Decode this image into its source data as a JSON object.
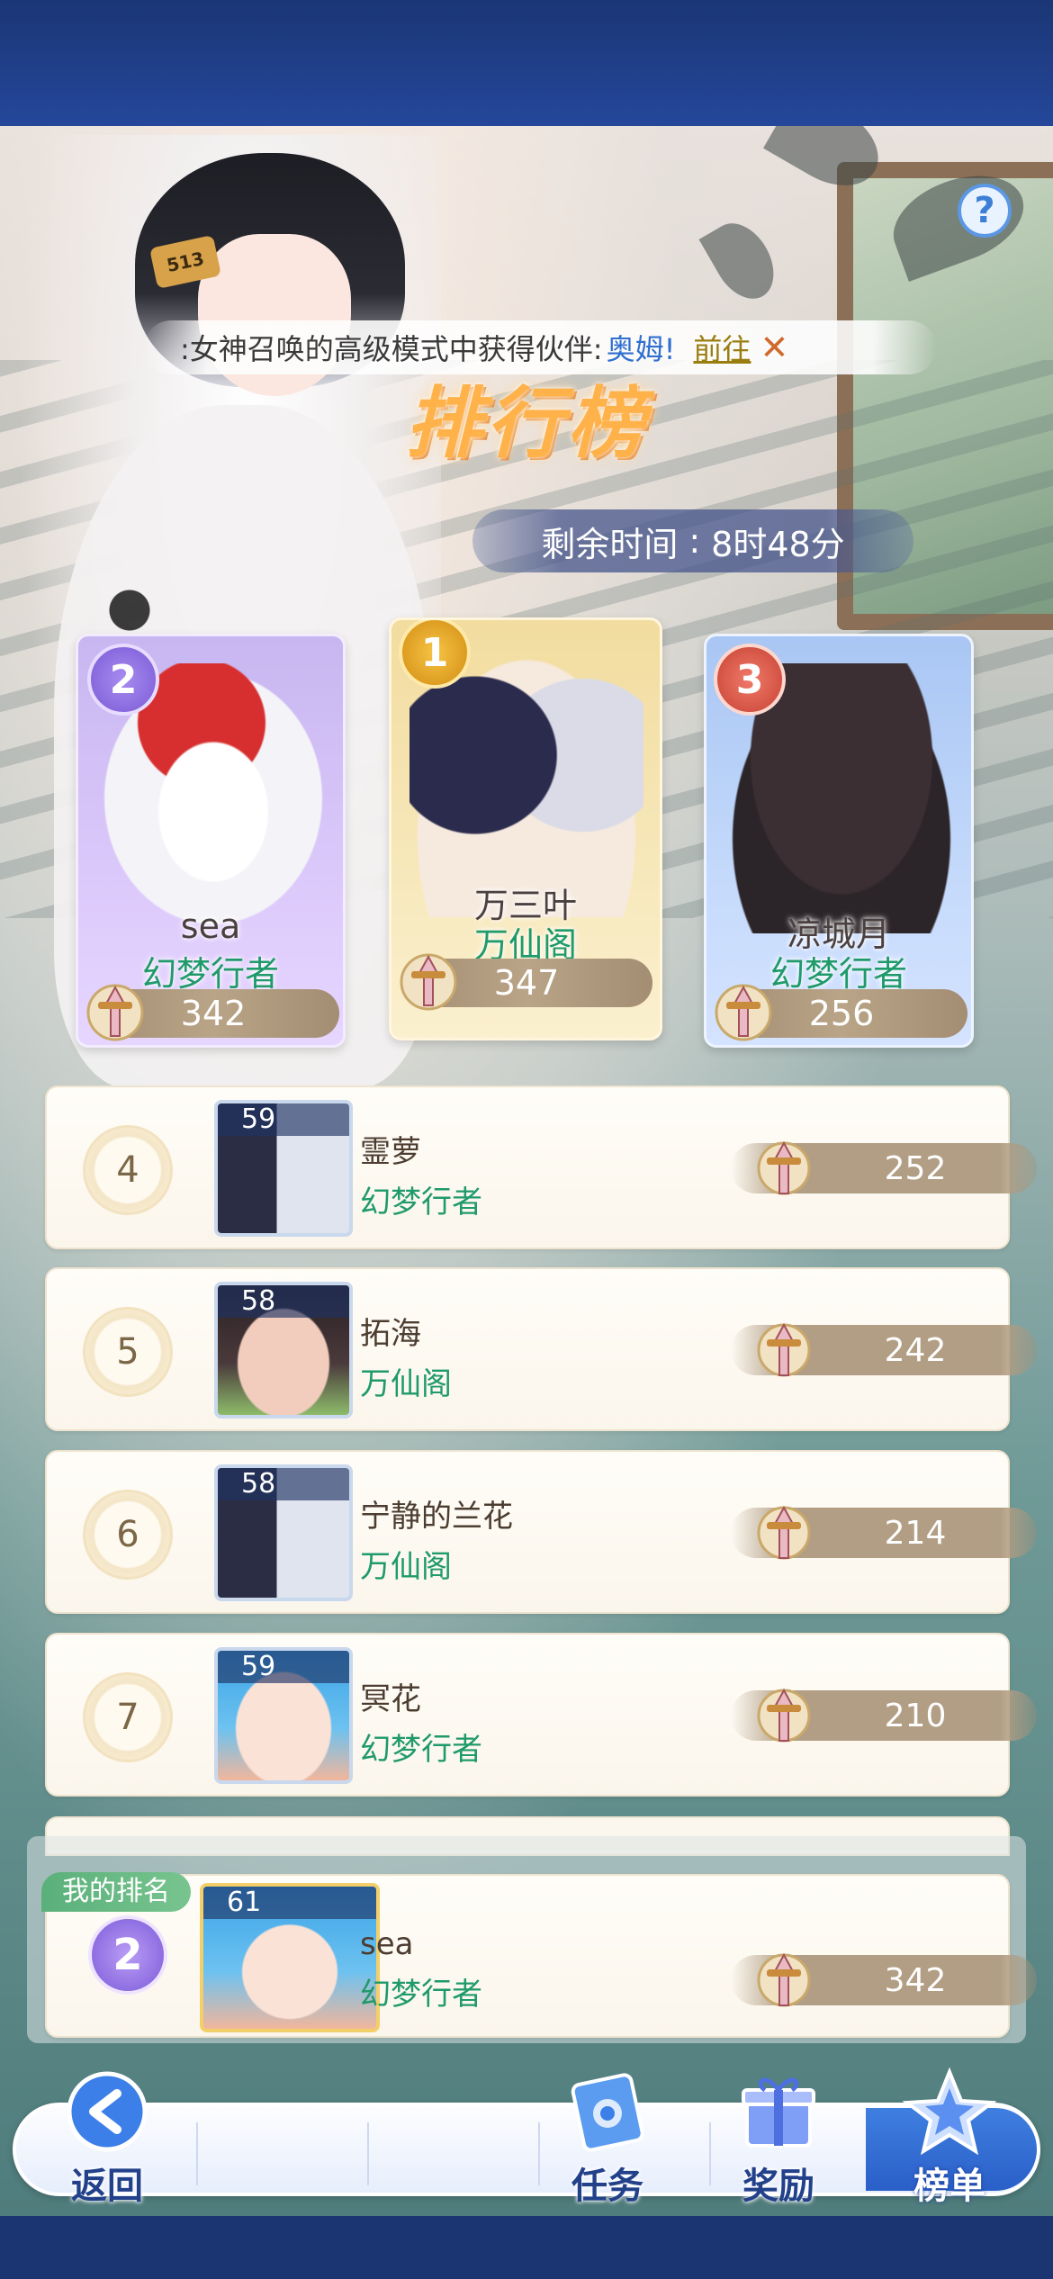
{
  "announcement": {
    "text": ":女神召唤的高级模式中获得伙伴:",
    "highlight": "奥姆!",
    "link": "前往",
    "close": "✕"
  },
  "header": {
    "title": "排行榜",
    "timer_label": "剩余时间",
    "timer_sep": ":",
    "timer_value": "8时48分",
    "help": "?"
  },
  "podium": [
    {
      "rank": "2",
      "name": "sea",
      "guild": "幻梦行者",
      "score": "342"
    },
    {
      "rank": "1",
      "name": "万三叶",
      "guild": "万仙阁",
      "score": "347"
    },
    {
      "rank": "3",
      "name": "凉城月",
      "guild": "幻梦行者",
      "score": "256"
    }
  ],
  "rows": [
    {
      "rank": "4",
      "level": "59",
      "name": "霊萝",
      "guild": "幻梦行者",
      "score": "252"
    },
    {
      "rank": "5",
      "level": "58",
      "name": "拓海",
      "guild": "万仙阁",
      "score": "242"
    },
    {
      "rank": "6",
      "level": "58",
      "name": "宁静的兰花",
      "guild": "万仙阁",
      "score": "214"
    },
    {
      "rank": "7",
      "level": "59",
      "name": "冥花",
      "guild": "幻梦行者",
      "score": "210"
    }
  ],
  "my_rank": {
    "label": "我的排名",
    "rank": "2",
    "level": "61",
    "name": "sea",
    "guild": "幻梦行者",
    "score": "342"
  },
  "decor": {
    "tag": "513"
  },
  "nav": {
    "back": "返回",
    "tasks": "任务",
    "rewards": "奖励",
    "ranking": "榜单"
  }
}
